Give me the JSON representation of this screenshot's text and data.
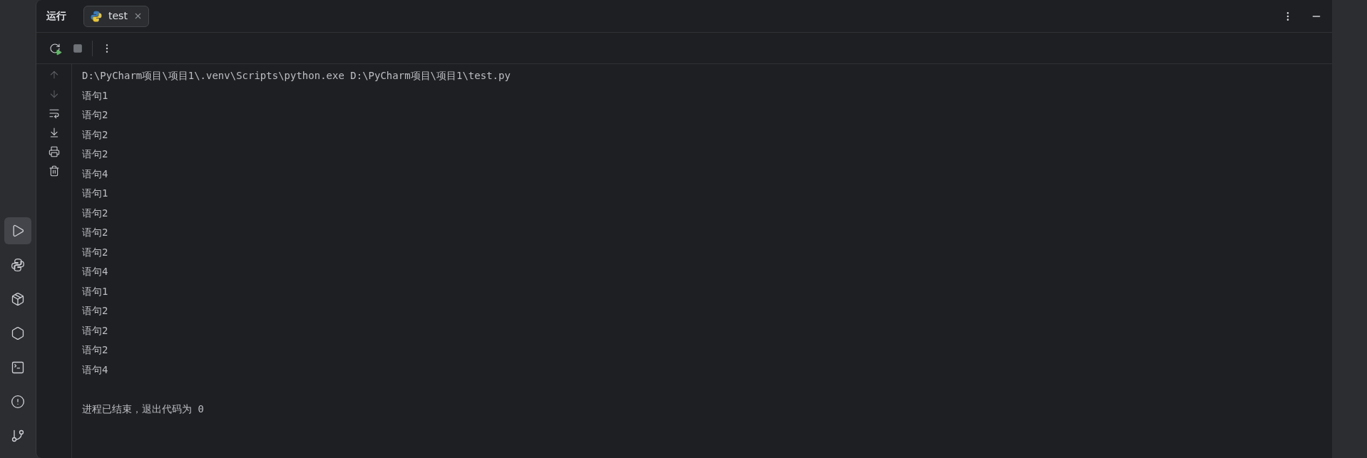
{
  "sidebar": {
    "items": [
      {
        "kind": "run",
        "selected": true
      },
      {
        "kind": "python",
        "selected": false
      },
      {
        "kind": "packages",
        "selected": false
      },
      {
        "kind": "services",
        "selected": false
      },
      {
        "kind": "terminal",
        "selected": false
      },
      {
        "kind": "problems",
        "selected": false
      },
      {
        "kind": "git",
        "selected": false
      }
    ]
  },
  "tool_window": {
    "title": "运行",
    "tabs": [
      {
        "label": "test",
        "selected": true
      }
    ]
  },
  "toolbar": [
    {
      "kind": "rerun",
      "disabled": false
    },
    {
      "kind": "stop",
      "disabled": true
    },
    {
      "kind": "more",
      "disabled": false
    }
  ],
  "gutter_tools": [
    {
      "kind": "up",
      "disabled": true
    },
    {
      "kind": "down",
      "disabled": true
    },
    {
      "kind": "wrap",
      "disabled": false
    },
    {
      "kind": "scroll-end",
      "disabled": false
    },
    {
      "kind": "print",
      "disabled": false
    },
    {
      "kind": "clear",
      "disabled": false
    }
  ],
  "console": {
    "lines": [
      "D:\\PyCharm项目\\项目1\\.venv\\Scripts\\python.exe D:\\PyCharm项目\\项目1\\test.py",
      "语句1",
      "语句2",
      "语句2",
      "语句2",
      "语句4",
      "语句1",
      "语句2",
      "语句2",
      "语句2",
      "语句4",
      "语句1",
      "语句2",
      "语句2",
      "语句2",
      "语句4"
    ],
    "exit_message": "进程已结束，退出代码为 0"
  }
}
